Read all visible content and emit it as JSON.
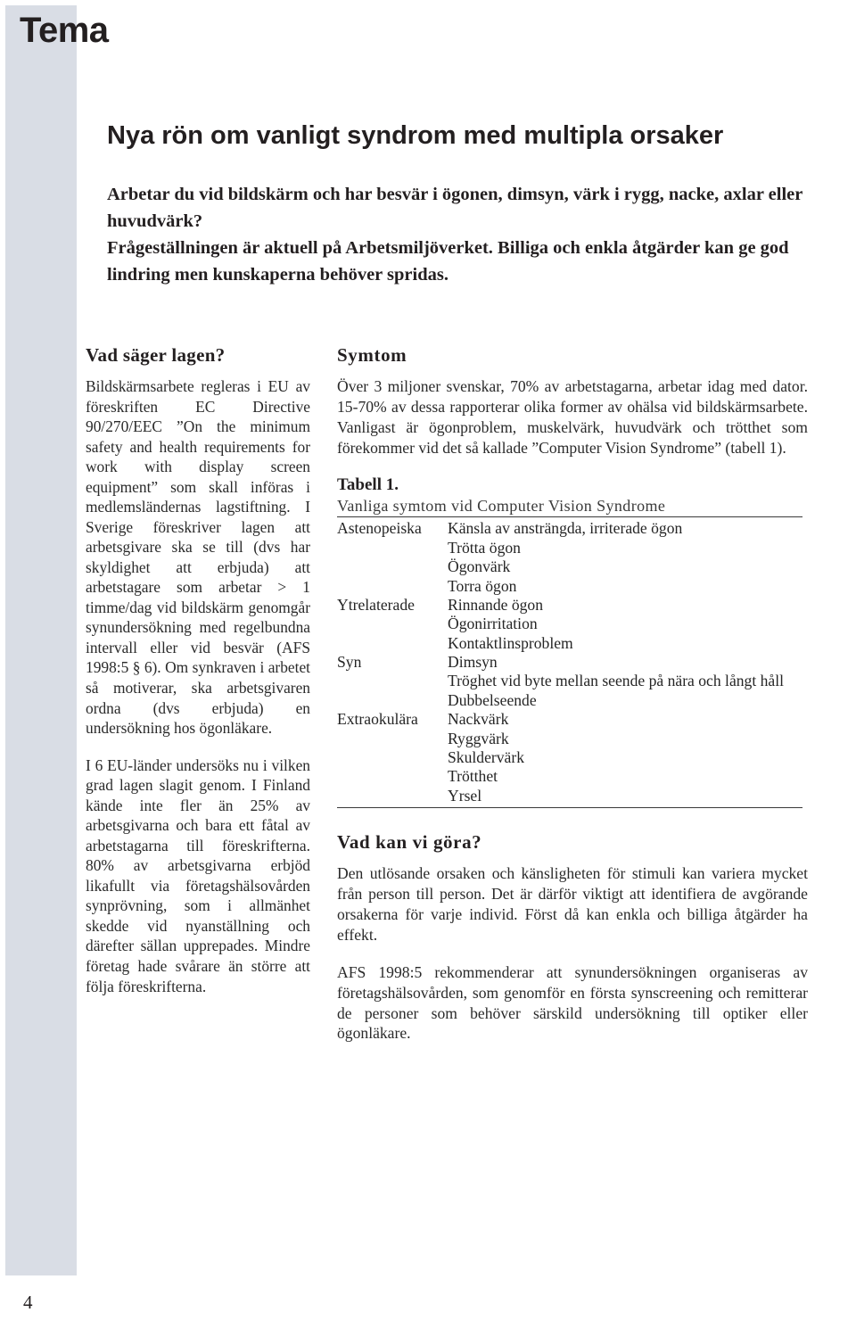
{
  "page": {
    "kicker": "Tema",
    "page_number": "4",
    "sidebar_color": "#d9dde5"
  },
  "headline": "Nya rön om vanligt syndrom med multipla orsaker",
  "standfirst": [
    "Arbetar du vid bildskärm och har besvär i ögonen, dimsyn, värk i rygg, nacke, axlar eller huvudvärk?",
    "Frågeställningen är aktuell på Arbetsmiljöverket. Billiga och enkla åtgärder kan ge god lindring men kunskaperna behöver spridas."
  ],
  "left_column": {
    "heading": "Vad säger lagen?",
    "paragraphs": [
      "Bildskärmsarbete regleras i EU av föreskriften EC Directive 90/270/EEC ”On the minimum safety and health requirements for work with display screen equipment” som skall införas i medlemsländernas lagstiftning. I Sverige föreskriver lagen att arbetsgivare ska se till (dvs har skyldighet att erbjuda) att arbetstagare som arbetar > 1 timme/dag vid bildskärm genomgår synundersökning med regelbundna intervall eller vid besvär (AFS 1998:5 § 6). Om synkraven i arbetet så motiverar, ska arbetsgivaren ordna (dvs erbjuda) en undersökning hos ögonläkare.",
      "I 6 EU-länder undersöks nu i vilken grad lagen slagit genom. I Finland kände inte fler än 25% av arbetsgivarna och bara ett fåtal av arbetstagarna till föreskrifterna. 80% av arbetsgivarna erbjöd likafullt via företagshälsovården synprövning, som i allmänhet skedde vid nyanställning och därefter sällan upprepades. Mindre företag hade svårare än större att följa föreskrifterna."
    ]
  },
  "right_column": {
    "heading_symtom": "Symtom",
    "symtom_paragraph": "Över 3 miljoner svenskar, 70% av arbetstagarna, arbetar idag med dator. 15-70% av dessa rapporterar olika former av ohälsa vid bildskärmsarbete. Vanligast är ögonproblem, muskelvärk, huvudvärk och trötthet som förekommer vid det så kallade ”Computer Vision Syndrome” (tabell 1).",
    "table": {
      "label": "Tabell 1.",
      "caption": "Vanliga symtom vid Computer Vision Syndrome",
      "rows": [
        {
          "group": "Astenopeiska",
          "symptom": "Känsla av ansträngda, irriterade ögon"
        },
        {
          "group": "",
          "symptom": "Trötta ögon"
        },
        {
          "group": "",
          "symptom": "Ögonvärk"
        },
        {
          "group": "",
          "symptom": "Torra ögon"
        },
        {
          "group": "Ytrelaterade",
          "symptom": "Rinnande ögon"
        },
        {
          "group": "",
          "symptom": "Ögonirritation"
        },
        {
          "group": "",
          "symptom": "Kontaktlinsproblem"
        },
        {
          "group": "Syn",
          "symptom": "Dimsyn"
        },
        {
          "group": "",
          "symptom": "Tröghet vid byte mellan seende på nära och långt håll"
        },
        {
          "group": "",
          "symptom": "Dubbelseende"
        },
        {
          "group": "Extraokulära",
          "symptom": "Nackvärk"
        },
        {
          "group": "",
          "symptom": "Ryggvärk"
        },
        {
          "group": "",
          "symptom": "Skuldervärk"
        },
        {
          "group": "",
          "symptom": "Trötthet"
        },
        {
          "group": "",
          "symptom": "Yrsel"
        }
      ]
    },
    "heading_atgarder": "Vad kan vi göra?",
    "atgarder_paragraphs": [
      "Den utlösande orsaken och känsligheten för stimuli kan variera mycket från person till person. Det är därför viktigt att identifiera de avgörande orsakerna för varje individ. Först då kan enkla och billiga åtgärder ha effekt.",
      "AFS 1998:5 rekommenderar att synundersökningen organiseras av företagshälsovården, som genomför en första synscreening och remitterar de personer som behöver särskild undersökning till optiker eller ögonläkare."
    ]
  }
}
